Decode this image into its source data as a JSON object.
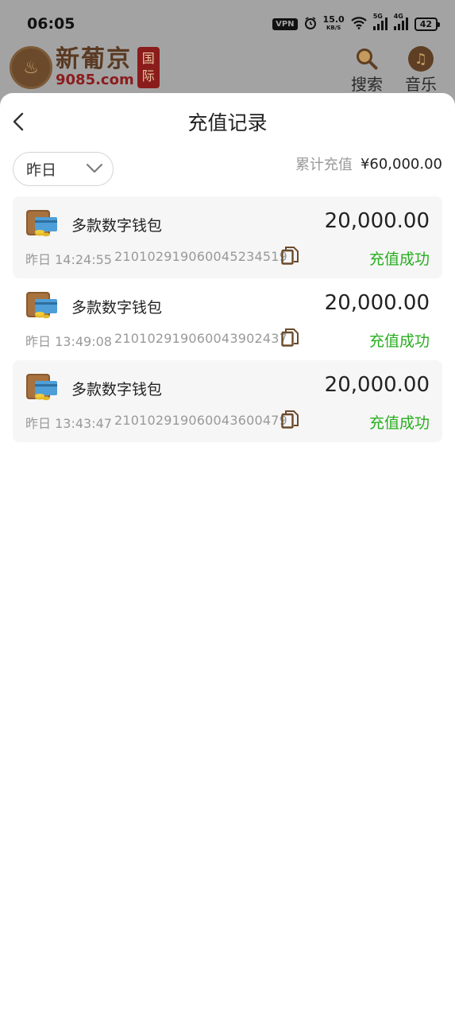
{
  "status_bar": {
    "time": "06:05",
    "vpn": "VPN",
    "speed_value": "15.0",
    "speed_unit": "KB/S",
    "net1": "5G",
    "net2": "4G",
    "battery": "42"
  },
  "app_header": {
    "logo_cn": "新葡京",
    "logo_en": "9085.com",
    "logo_seal_1": "国",
    "logo_seal_2": "际",
    "search_label": "搜索",
    "music_label": "音乐"
  },
  "sheet": {
    "title": "充值记录",
    "date_filter": "昨日",
    "total_label": "累计充值",
    "total_value": "¥60,000.00"
  },
  "records": [
    {
      "name": "多款数字钱包",
      "amount": "20,000.00",
      "time": "昨日 14:24:55",
      "order_no": "21010291906004523451​9",
      "status": "充值成功"
    },
    {
      "name": "多款数字钱包",
      "amount": "20,000.00",
      "time": "昨日 13:49:08",
      "order_no": "210102919060043902437",
      "status": "充值成功"
    },
    {
      "name": "多款数字钱包",
      "amount": "20,000.00",
      "time": "昨日 13:43:47",
      "order_no": "210102919060043600479",
      "status": "充值成功"
    }
  ],
  "colors": {
    "success": "#27ae1e",
    "brand_brown": "#5e3f24",
    "overlay_grey": "#a3a3a3"
  }
}
